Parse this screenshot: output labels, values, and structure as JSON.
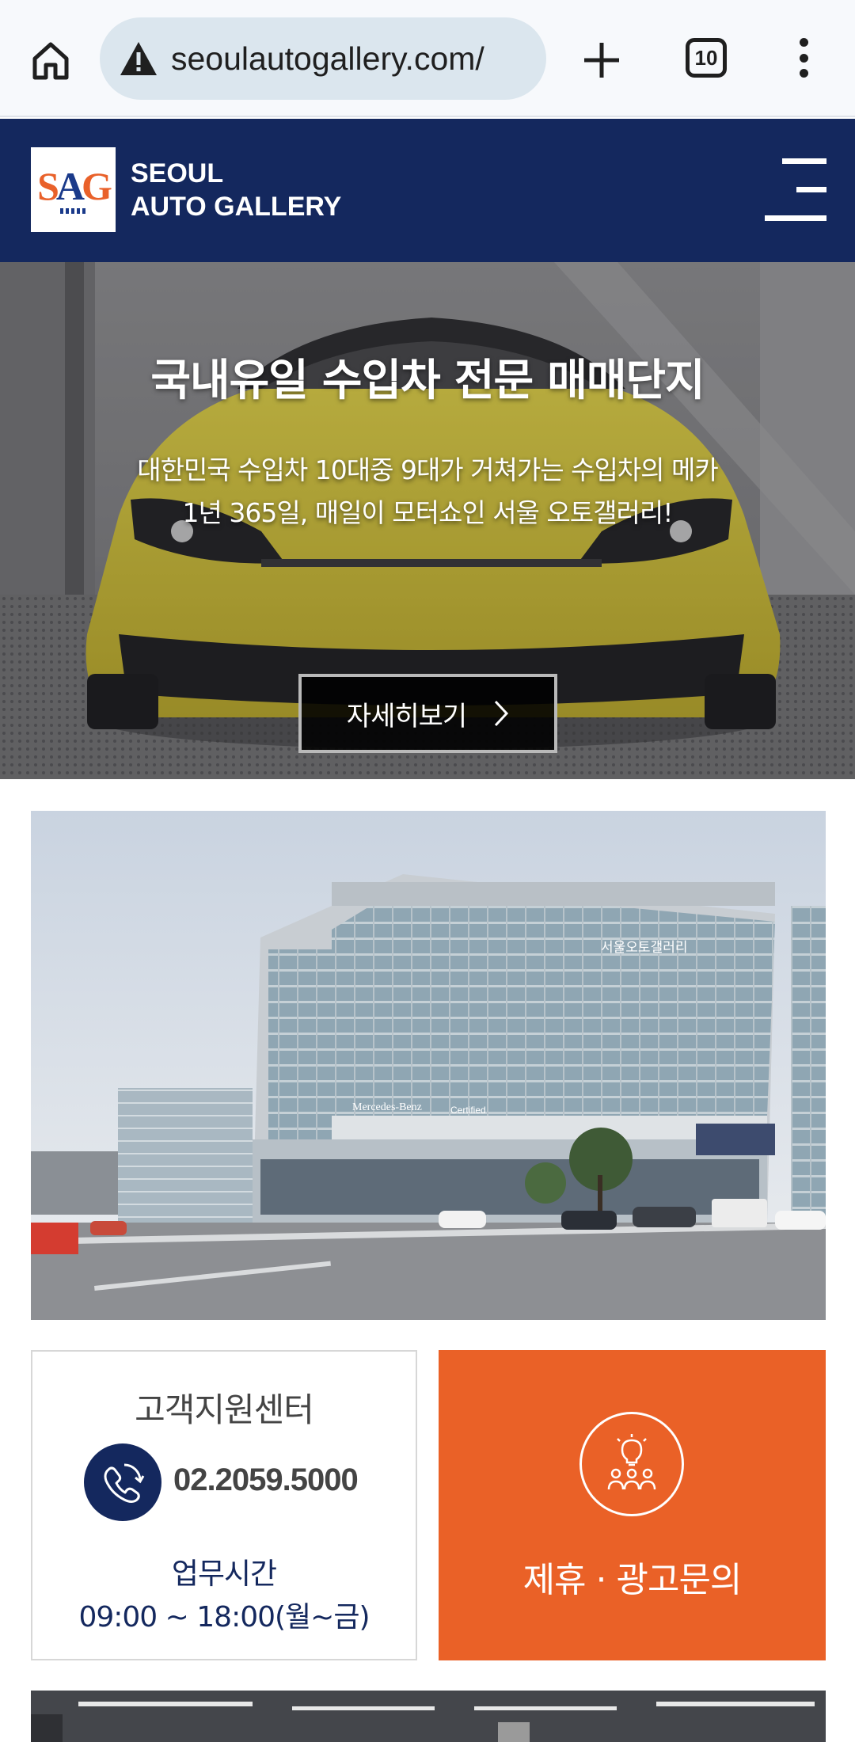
{
  "browser": {
    "url": "seoulautogallery.com/",
    "tab_count": "10"
  },
  "header": {
    "logo_letters": {
      "s": "S",
      "a": "A",
      "g": "G"
    },
    "brand_line1": "SEOUL",
    "brand_line2": "AUTO GALLERY"
  },
  "hero": {
    "title": "국내유일 수입차 전문 매매단지",
    "subtitle_line1": "대한민국 수입차 10대중 9대가 거쳐가는 수입차의 메카",
    "subtitle_line2": "1년 365일, 매일이 모터쇼인 서울 오토갤러리!",
    "button_label": "자세히보기"
  },
  "building_photo": {
    "sign_text": "서울오토갤러리",
    "storefront_sign_1": "Mercedes-Benz",
    "storefront_sign_2": "Certified"
  },
  "support": {
    "title": "고객지원센터",
    "phone": "02.2059.5000",
    "hours_label": "업무시간",
    "hours": "09:00 ~ 18:00(월~금)"
  },
  "partner": {
    "label": "제휴 · 광고문의"
  },
  "colors": {
    "navy": "#14285e",
    "orange": "#ea6127",
    "car_yellow": "#e8d83a"
  }
}
